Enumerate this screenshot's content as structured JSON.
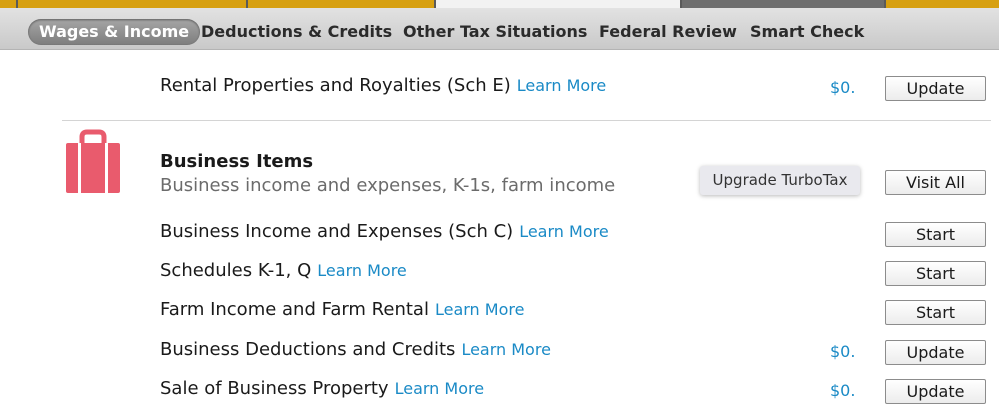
{
  "nav": {
    "tabs": [
      {
        "label": "Wages & Income",
        "active": true
      },
      {
        "label": "Deductions & Credits",
        "active": false
      },
      {
        "label": "Other Tax Situations",
        "active": false
      },
      {
        "label": "Federal Review",
        "active": false
      },
      {
        "label": "Smart Check",
        "active": false
      }
    ]
  },
  "colors": {
    "progress_gold": "#d7a011",
    "progress_gray": "#6e6e6e",
    "progress_light": "#f2f2f2",
    "link_blue": "#1a8ac6",
    "briefcase_red": "#e95b6d"
  },
  "rental": {
    "label": "Rental Properties and Royalties (Sch E)",
    "learn_more": "Learn More",
    "amount": "$0.",
    "button": "Update"
  },
  "business": {
    "icon": "briefcase-icon",
    "title": "Business Items",
    "subtitle": "Business income and expenses, K-1s, farm income",
    "upgrade_label": "Upgrade TurboTax",
    "visit_all_label": "Visit All",
    "rows": [
      {
        "label": "Business Income and Expenses (Sch C)",
        "learn_more": "Learn More",
        "amount": "",
        "button": "Start"
      },
      {
        "label": "Schedules K-1, Q",
        "learn_more": "Learn More",
        "amount": "",
        "button": "Start"
      },
      {
        "label": "Farm Income and Farm Rental",
        "learn_more": "Learn More",
        "amount": "",
        "button": "Start"
      },
      {
        "label": "Business Deductions and Credits",
        "learn_more": "Learn More",
        "amount": "$0.",
        "button": "Update"
      },
      {
        "label": "Sale of Business Property",
        "learn_more": "Learn More",
        "amount": "$0.",
        "button": "Update"
      }
    ]
  }
}
